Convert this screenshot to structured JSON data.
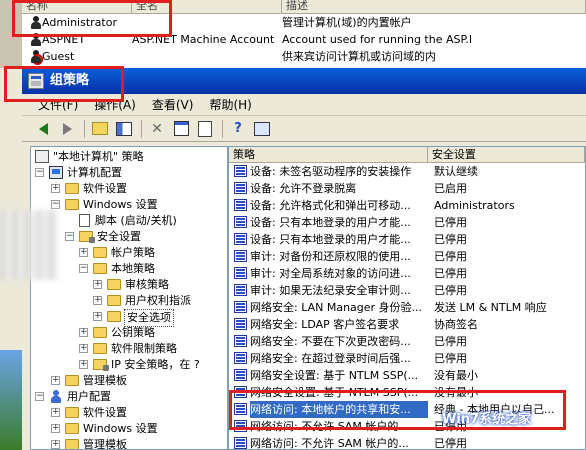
{
  "user_list": {
    "headers": [
      "名称",
      "全名",
      "描述"
    ],
    "rows": [
      {
        "name": "Administrator",
        "fullname": "",
        "desc": "管理计算机(域)的内置帐户"
      },
      {
        "name": "ASPNET",
        "fullname": "ASP.NET Machine Account",
        "desc": "Account used for running the ASP.I"
      },
      {
        "name": "Guest",
        "fullname": "",
        "desc": "供来宾访问计算机或访问域的内"
      }
    ]
  },
  "window": {
    "title": "组策略"
  },
  "menu": [
    "文件(F)",
    "操作(A)",
    "查看(V)",
    "帮助(H)"
  ],
  "tree": {
    "root": "\"本地计算机\" 策略",
    "computer_config": "计算机配置",
    "software_settings": "软件设置",
    "windows_settings": "Windows 设置",
    "scripts": "脚本 (启动/关机)",
    "security_settings": "安全设置",
    "account_policy": "帐户策略",
    "local_policy": "本地策略",
    "audit_policy": "审核策略",
    "user_rights": "用户权利指派",
    "security_options": "安全选项",
    "public_key": "公钥策略",
    "software_restriction": "软件限制策略",
    "ipsec": "IP 安全策略，在 ?",
    "admin_templates": "管理模板",
    "user_config": "用户配置",
    "u_software": "软件设置",
    "u_windows": "Windows 设置",
    "u_admin": "管理模板"
  },
  "list": {
    "col_policy": "策略",
    "col_setting": "安全设置",
    "rows": [
      {
        "policy": "设备: 未签名驱动程序的安装操作",
        "setting": "默认继续"
      },
      {
        "policy": "设备: 允许不登录脱离",
        "setting": "已启用"
      },
      {
        "policy": "设备: 允许格式化和弹出可移动...",
        "setting": "Administrators"
      },
      {
        "policy": "设备: 只有本地登录的用户才能...",
        "setting": "已停用"
      },
      {
        "policy": "设备: 只有本地登录的用户才能...",
        "setting": "已停用"
      },
      {
        "policy": "审计: 对备份和还原权限的使用...",
        "setting": "已停用"
      },
      {
        "policy": "审计: 对全局系统对象的访问进...",
        "setting": "已停用"
      },
      {
        "policy": "审计: 如果无法纪录安全审计则...",
        "setting": "已停用"
      },
      {
        "policy": "网络安全: LAN Manager 身份验...",
        "setting": "发送 LM & NTLM 响应"
      },
      {
        "policy": "网络安全: LDAP 客户签名要求",
        "setting": "协商签名"
      },
      {
        "policy": "网络安全: 不要在下次更改密码...",
        "setting": "已停用"
      },
      {
        "policy": "网络安全: 在超过登录时间后强...",
        "setting": "已停用"
      },
      {
        "policy": "网络安全设置: 基于 NTLM SSP(...",
        "setting": "没有最小"
      },
      {
        "policy": "网络安全设置: 基于 NTLM SSP(...",
        "setting": "没有最小"
      },
      {
        "policy": "网络访问: 本地帐户的共享和安...",
        "setting": "经典 - 本地用户以自己..."
      },
      {
        "policy": "网络访问: 不允许 SAM 帐户的...",
        "setting": "已停用"
      },
      {
        "policy": "网络访问: 不允许 SAM 帐户的...",
        "setting": "已停用"
      }
    ]
  },
  "watermark": "Win7系统之家"
}
